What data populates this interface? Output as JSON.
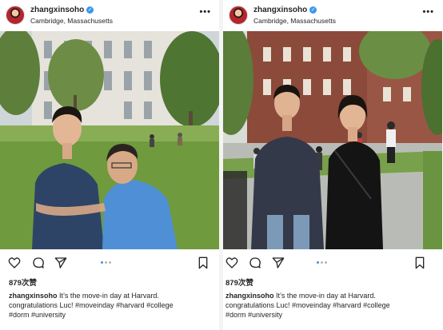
{
  "posts": [
    {
      "username": "zhangxinsoho",
      "location": "Cambridge, Massachusetts",
      "likes": "879次赞",
      "caption_user": "zhangxinsoho",
      "caption_line1": "It’s the move-in day at Harvard.",
      "caption_line2": "congratulations Luc! #moveinday #harvard #college",
      "caption_line3": "#dorm #university",
      "more_icon": "•••"
    },
    {
      "username": "zhangxinsoho",
      "location": "Cambridge, Massachusetts",
      "likes": "879次赞",
      "caption_user": "zhangxinsoho",
      "caption_line1": "It’s the move-in day at Harvard.",
      "caption_line2": "congratulations Luc! #moveinday #harvard #college",
      "caption_line3": "#dorm #university",
      "more_icon": "•••"
    }
  ],
  "icons": {
    "like": "heart-icon",
    "comment": "comment-icon",
    "share": "send-icon",
    "save": "bookmark-icon",
    "verified": "verified-badge-icon"
  },
  "colors": {
    "verified_blue": "#3897f0",
    "text": "#262626",
    "carousel_active": "#3897f0"
  },
  "carousel": {
    "total": 3,
    "active": 1
  }
}
